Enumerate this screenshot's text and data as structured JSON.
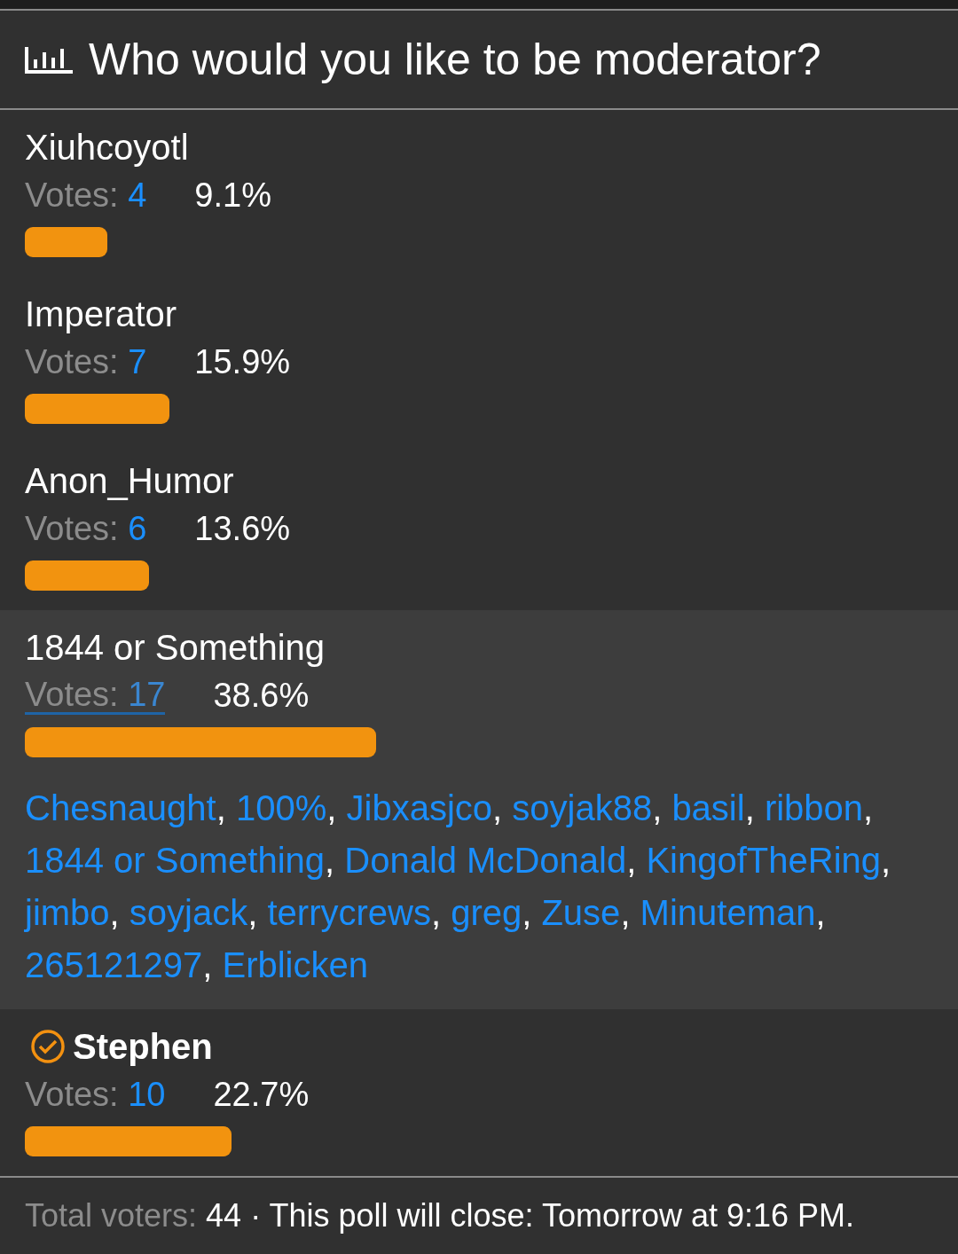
{
  "poll": {
    "title": "Who would you like to be moderator?"
  },
  "options": [
    {
      "name": "Xiuhcoyotl",
      "votes_label": "Votes:",
      "votes": "4",
      "percent": "9.1%",
      "expanded": false,
      "voted": false
    },
    {
      "name": "Imperator",
      "votes_label": "Votes:",
      "votes": "7",
      "percent": "15.9%",
      "expanded": false,
      "voted": false
    },
    {
      "name": "Anon_Humor",
      "votes_label": "Votes:",
      "votes": "6",
      "percent": "13.6%",
      "expanded": false,
      "voted": false
    },
    {
      "name": "1844 or Something",
      "votes_label": "Votes:",
      "votes": "17",
      "percent": "38.6%",
      "expanded": true,
      "voted": false,
      "separator": ", ",
      "voters": [
        "Chesnaught",
        "100%",
        "Jibxasjco",
        "soyjak88",
        "basil",
        "ribbon",
        "1844 or Something",
        "Donald McDonald",
        "KingofTheRing",
        "jimbo",
        "soyjack",
        "terrycrews",
        "greg",
        "Zuse",
        "Minuteman",
        "265121297",
        "Erblicken"
      ]
    },
    {
      "name": "Stephen",
      "votes_label": "Votes:",
      "votes": "10",
      "percent": "22.7%",
      "expanded": false,
      "voted": true
    }
  ],
  "footer": {
    "total_label": "Total voters:",
    "total": "44",
    "close_text": "· This poll will close: Tomorrow at 9:16 PM."
  }
}
